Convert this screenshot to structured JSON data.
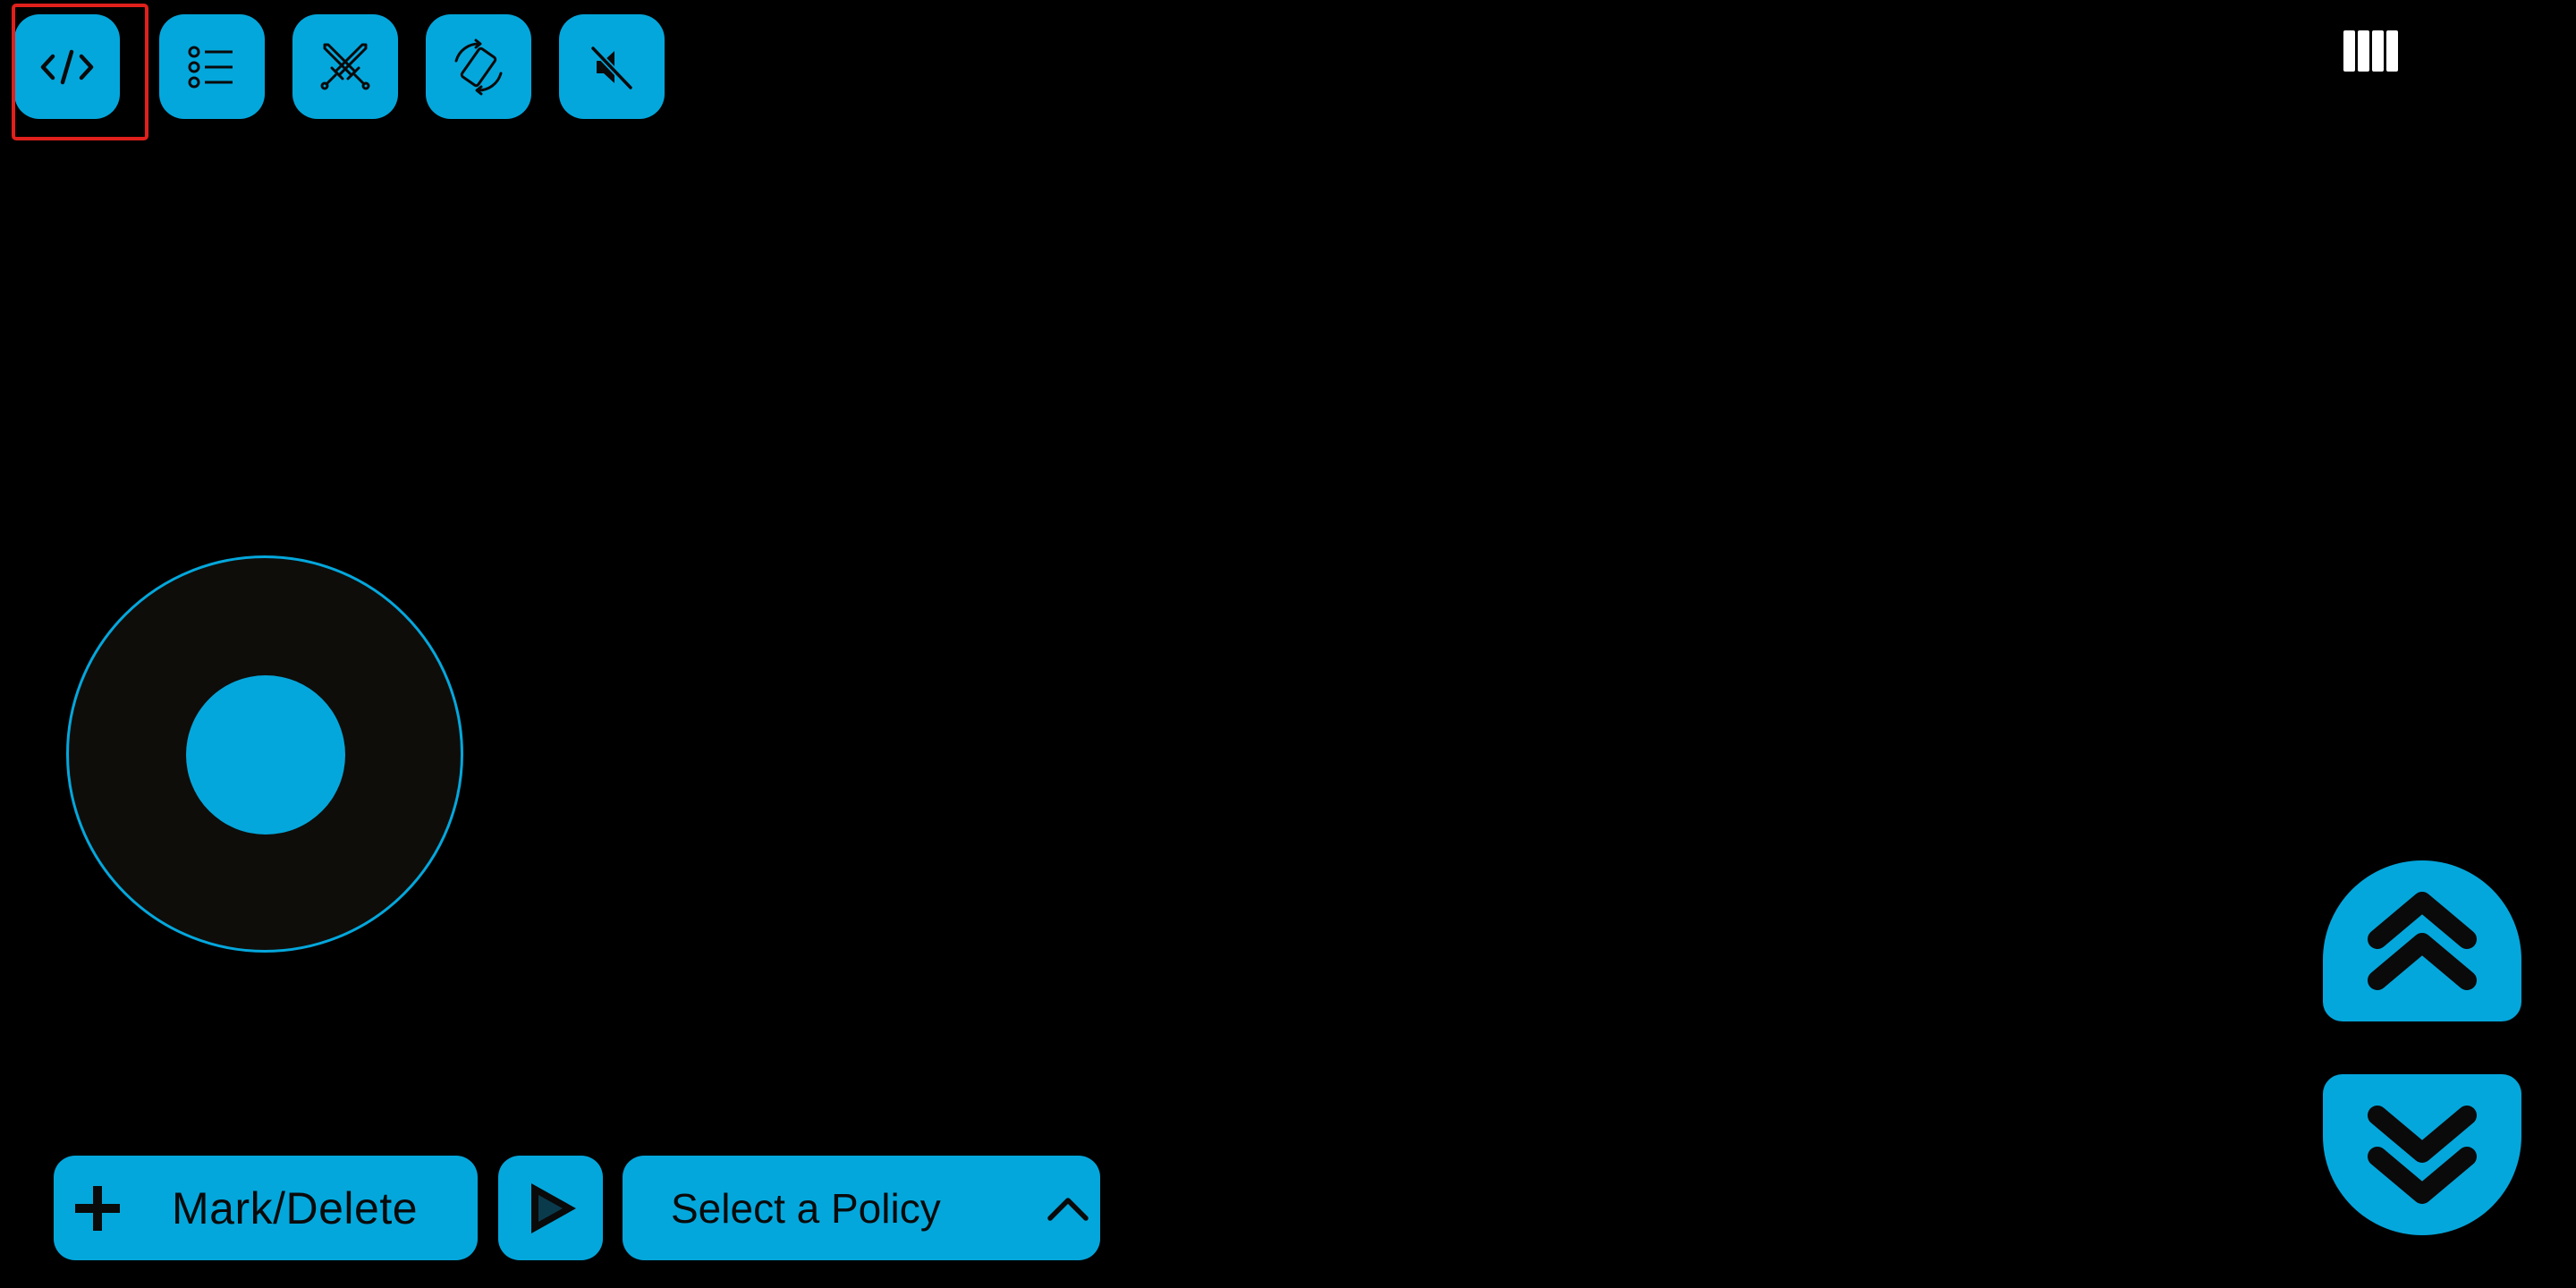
{
  "colors": {
    "background": "#000000",
    "accent": "#04a7dc",
    "joystick_base": "#0e0d0a",
    "icon_dark": "#0a0a0a",
    "highlight": "#e0201c",
    "battery": "#ffffff"
  },
  "toolbar": {
    "buttons": [
      {
        "name": "code-button",
        "icon": "code-icon",
        "highlighted": true
      },
      {
        "name": "list-button",
        "icon": "list-icon"
      },
      {
        "name": "battle-button",
        "icon": "crossed-swords-icon"
      },
      {
        "name": "rotate-screen-button",
        "icon": "screen-rotate-icon"
      },
      {
        "name": "sound-toggle-button",
        "icon": "volume-mute-icon"
      }
    ]
  },
  "status": {
    "battery_icon": "battery-full-icon",
    "battery_level": 1.0
  },
  "joystick": {
    "knob_offset": [
      0,
      0
    ]
  },
  "bottom_bar": {
    "mark_delete_label": "Mark/Delete",
    "mark_delete_icon": "plus-icon",
    "play_icon": "play-icon",
    "policy_placeholder": "Select a Policy",
    "policy_chevron_icon": "chevron-up-icon"
  },
  "elevation": {
    "up_icon": "double-chevron-up-icon",
    "down_icon": "double-chevron-down-icon"
  }
}
